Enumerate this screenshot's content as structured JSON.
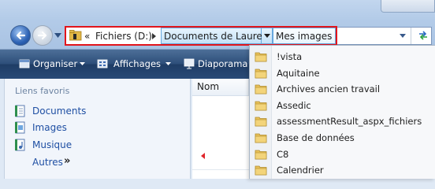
{
  "address": {
    "drive_crumb": "Fichiers (D:)",
    "folder_crumb": "Documents de Laurent",
    "current_crumb": "Mes images",
    "overflow_glyph": "«"
  },
  "toolbar": {
    "organize_label": "Organiser",
    "views_label": "Affichages",
    "slideshow_label": "Diaporama"
  },
  "favorites": {
    "heading": "Liens favoris",
    "items": [
      {
        "label": "Documents",
        "icon": "documents-icon"
      },
      {
        "label": "Images",
        "icon": "pictures-icon"
      },
      {
        "label": "Musique",
        "icon": "music-icon"
      }
    ],
    "more_label": "Autres",
    "more_glyph": "»"
  },
  "columns": {
    "name_header": "Nom"
  },
  "dropdown": {
    "items": [
      {
        "label": "!vista"
      },
      {
        "label": "Aquitaine"
      },
      {
        "label": "Archives ancien travail"
      },
      {
        "label": "Assedic"
      },
      {
        "label": "assessmentResult_aspx_fichiers"
      },
      {
        "label": "Base de données"
      },
      {
        "label": "C8"
      },
      {
        "label": "Calendrier"
      }
    ]
  },
  "colors": {
    "highlight_border": "#e2141b",
    "toolbar_bg": "#2e4f7a",
    "folder_yellow": "#e9c25a",
    "link_blue": "#1f4fa3"
  }
}
